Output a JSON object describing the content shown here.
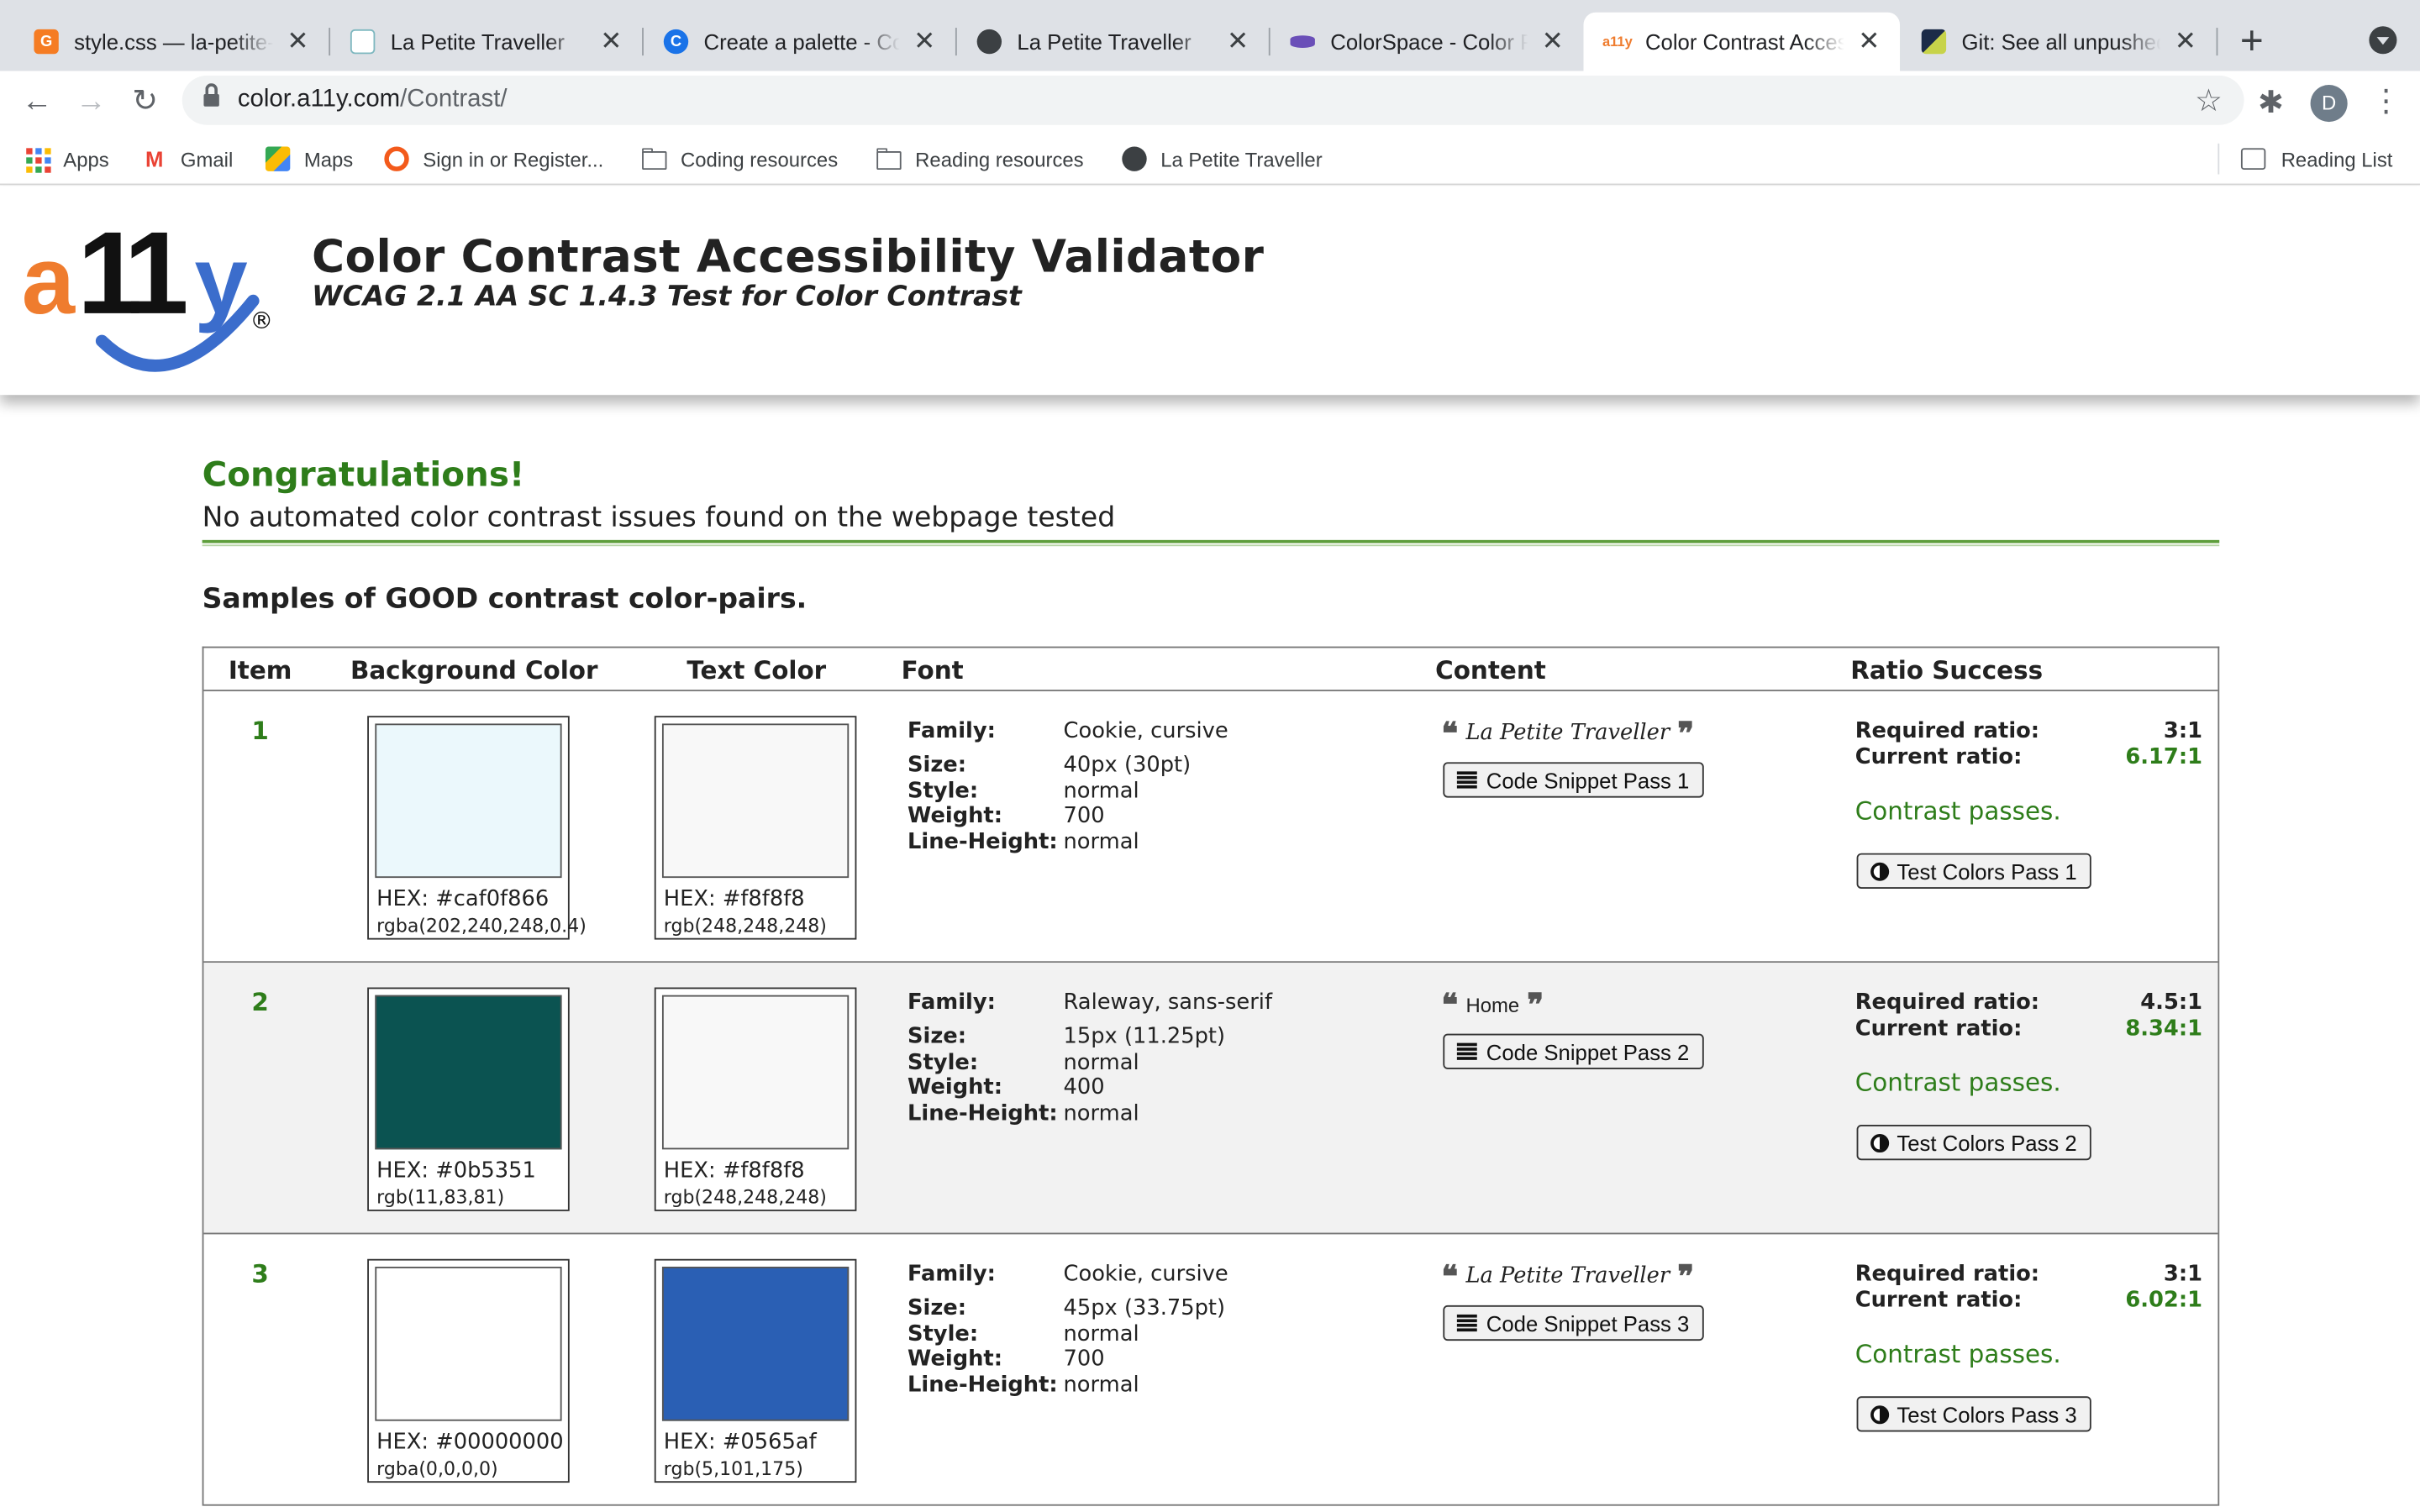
{
  "browser": {
    "tabs": [
      {
        "title": "style.css — la-petite-traveller",
        "favicon_color": "#f57c23",
        "favicon_glyph": "G"
      },
      {
        "title": "La Petite Traveller",
        "favicon_color": "#ffffff",
        "favicon_glyph": ""
      },
      {
        "title": "Create a palette - Coolors",
        "favicon_color": "#1a73e8",
        "favicon_glyph": "C"
      },
      {
        "title": "La Petite Traveller",
        "favicon_color": "#3c4043",
        "favicon_glyph": ""
      },
      {
        "title": "ColorSpace - Color Palettes",
        "favicon_color": "#6a4fb8",
        "favicon_glyph": ""
      },
      {
        "title": "Color Contrast Accessibility Validator",
        "favicon_color": "#ffffff",
        "favicon_glyph": "a11y",
        "active": true
      },
      {
        "title": "Git: See all unpushed commits",
        "favicon_color": "#1b2b48",
        "favicon_glyph": ""
      }
    ],
    "url_host": "color.a11y.com",
    "url_path": "/Contrast/",
    "avatar_letter": "D",
    "bookmarks": [
      "Apps",
      "Gmail",
      "Maps",
      "Sign in or Register...",
      "Coding resources",
      "Reading resources",
      "La Petite Traveller"
    ],
    "reading_list": "Reading List"
  },
  "header": {
    "title": "Color Contrast Accessibility Validator",
    "subtitle": "WCAG 2.1 AA SC 1.4.3 Test for Color Contrast",
    "logo_text": "a11y",
    "logo_mark": "®",
    "logo_colors": {
      "a": "#ef7c2e",
      "ones": "#111111",
      "y": "#3b6dcc"
    }
  },
  "summary": {
    "heading": "Congratulations!",
    "message": "No automated color contrast issues found on the webpage tested",
    "samples_title": "Samples of GOOD contrast color-pairs."
  },
  "table": {
    "headers": {
      "item": "Item",
      "background": "Background Color",
      "text": "Text Color",
      "font": "Font",
      "content": "Content",
      "ratio": "Ratio Success"
    },
    "labels": {
      "family": "Family:",
      "size": "Size:",
      "style": "Style:",
      "weight": "Weight:",
      "line_height": "Line-Height:",
      "required": "Required ratio:",
      "current": "Current ratio:",
      "passes": "Contrast passes."
    },
    "rows": [
      {
        "item": "1",
        "bg_hex": "HEX: #caf0f866",
        "bg_rgb": "rgba(202,240,248,0.4)",
        "bg_swatch": "#ebf8fc",
        "text_hex": "HEX: #f8f8f8",
        "text_rgb": "rgb(248,248,248)",
        "text_swatch": "#f8f8f8",
        "family": "Cookie, cursive",
        "size": "40px (30pt)",
        "style": "normal",
        "weight": "700",
        "line_height": "normal",
        "content": "La Petite Traveller",
        "snippet_button": "Code Snippet Pass 1",
        "required_ratio": "3:1",
        "current_ratio": "6.17:1",
        "test_button": "Test Colors Pass 1"
      },
      {
        "item": "2",
        "bg_hex": "HEX: #0b5351",
        "bg_rgb": "rgb(11,83,81)",
        "bg_swatch": "#0b5351",
        "text_hex": "HEX: #f8f8f8",
        "text_rgb": "rgb(248,248,248)",
        "text_swatch": "#f8f8f8",
        "family": "Raleway, sans-serif",
        "size": "15px (11.25pt)",
        "style": "normal",
        "weight": "400",
        "line_height": "normal",
        "content": "Home",
        "snippet_button": "Code Snippet Pass 2",
        "required_ratio": "4.5:1",
        "current_ratio": "8.34:1",
        "test_button": "Test Colors Pass 2"
      },
      {
        "item": "3",
        "bg_hex": "HEX: #00000000",
        "bg_rgb": "rgba(0,0,0,0)",
        "bg_swatch": "#ffffff",
        "text_hex": "HEX: #0565af",
        "text_rgb": "rgb(5,101,175)",
        "text_swatch": "#2a5fb4",
        "family": "Cookie, cursive",
        "size": "45px (33.75pt)",
        "style": "normal",
        "weight": "700",
        "line_height": "normal",
        "content": "La Petite Traveller",
        "snippet_button": "Code Snippet Pass 3",
        "required_ratio": "3:1",
        "current_ratio": "6.02:1",
        "test_button": "Test Colors Pass 3"
      }
    ]
  },
  "colors": {
    "success_green": "#2e7d1a",
    "tabstrip": "#dee1e6"
  }
}
